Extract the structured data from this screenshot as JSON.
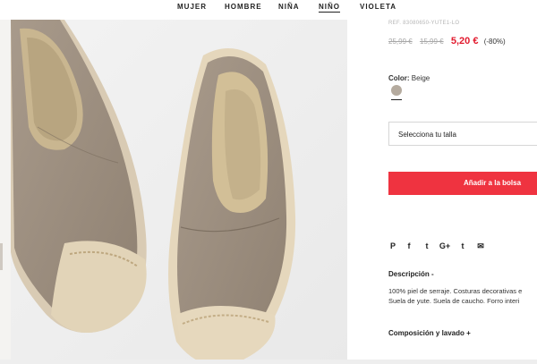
{
  "nav": {
    "items": [
      {
        "label": "MUJER"
      },
      {
        "label": "HOMBRE"
      },
      {
        "label": "NIÑA"
      },
      {
        "label": "NIÑO",
        "active": true
      },
      {
        "label": "VIOLETA"
      }
    ]
  },
  "product": {
    "reference": "REF. 83080650-YUTE1-LO",
    "price_original_1": "25,99 €",
    "price_original_2": "15,99 €",
    "price_current": "5,20 €",
    "discount": "(-80%)",
    "color_label": "Color:",
    "color_value": "Beige",
    "swatch_color": "#b5ab9f",
    "size_placeholder": "Selecciona tu talla",
    "add_to_bag": "Añadir a la bolsa"
  },
  "share": {
    "icons": [
      "pinterest-icon",
      "facebook-icon",
      "twitter-icon",
      "google-plus-icon",
      "tumblr-icon",
      "email-icon"
    ],
    "glyphs": [
      "P",
      "f",
      "t",
      "G+",
      "t",
      "✉"
    ]
  },
  "description": {
    "title": "Descripción  -",
    "line1": "100% piel de serraje. Costuras decorativas e",
    "line2": "Suela de yute. Suela de caucho. Forro interi"
  },
  "composition": {
    "title": "Composición y lavado  +"
  },
  "colors": {
    "accent_red": "#e21b2f",
    "button_red": "#ef3340"
  }
}
